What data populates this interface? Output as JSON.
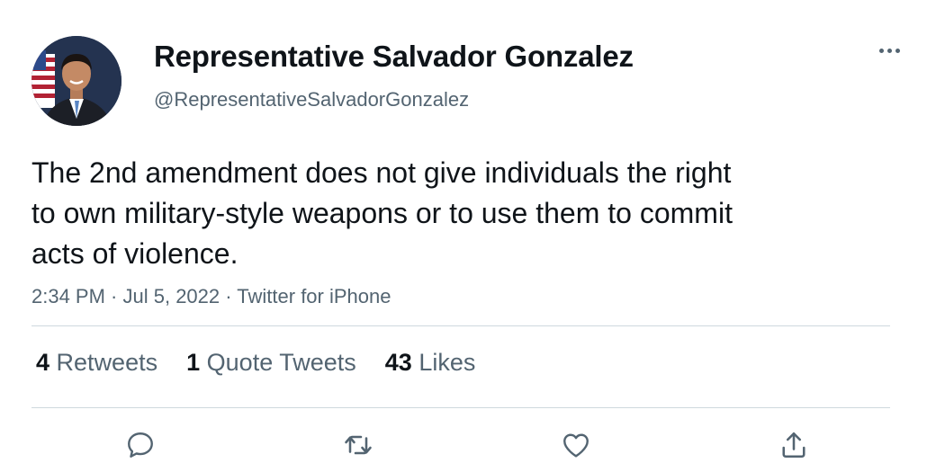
{
  "author": {
    "display_name": "Representative Salvador Gonzalez",
    "handle": "@RepresentativeSalvadorGonzalez",
    "avatar_icon": "profile-photo"
  },
  "tweet": {
    "lines": [
      "The 2nd amendment does not give individuals the right",
      "to own military-style weapons or to use them to commit",
      "acts of violence."
    ],
    "time": "2:34 PM",
    "date": "Jul 5, 2022",
    "source": "Twitter for iPhone",
    "separator": " · "
  },
  "stats": [
    {
      "count": "4",
      "label": "Retweets"
    },
    {
      "count": "1",
      "label": "Quote Tweets"
    },
    {
      "count": "43",
      "label": "Likes"
    }
  ],
  "actions": [
    {
      "name": "reply",
      "icon": "reply-icon"
    },
    {
      "name": "retweet",
      "icon": "retweet-icon"
    },
    {
      "name": "like",
      "icon": "heart-icon"
    },
    {
      "name": "share",
      "icon": "share-icon"
    }
  ],
  "colors": {
    "primary_text": "#0f1419",
    "secondary_text": "#536471",
    "divider": "#cfd9de"
  }
}
